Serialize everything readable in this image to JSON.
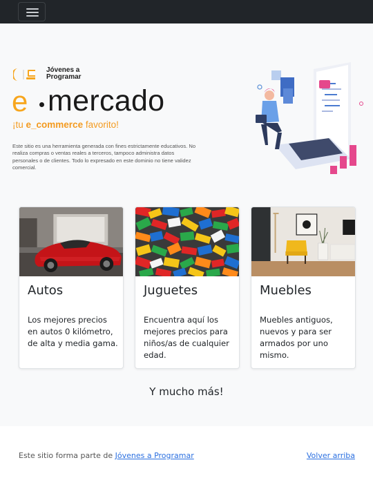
{
  "navbar": {
    "toggle_icon": "menu-icon"
  },
  "hero": {
    "logo_line1": "Jóvenes a",
    "logo_line2": "Programar",
    "brand_e": "e",
    "brand_word": "mercado",
    "tagline_pre": "¡tu ",
    "tagline_bold": "e_commerce",
    "tagline_post": " favorito!",
    "disclaimer": "Este sitio es una herramienta generada con fines estrictamente educativos. No realiza compras o ventas reales a terceros, tampoco administra datos personales o de clientes. Todo lo expresado en este dominio no tiene validez comercial.",
    "illustration": "person-with-laptop-coding-illustration"
  },
  "cards": [
    {
      "title": "Autos",
      "text": "Los mejores precios en autos 0 kilómetro, de alta y media gama.",
      "image": "red-sports-car"
    },
    {
      "title": "Juguetes",
      "text": "Encuentra aquí los mejores precios para niños/as de cualquier edad.",
      "image": "colorful-building-bricks"
    },
    {
      "title": "Muebles",
      "text": "Muebles antiguos, nuevos y para ser armados por uno mismo.",
      "image": "living-room-yellow-armchair"
    }
  ],
  "more_text": "Y mucho más!",
  "footer": {
    "text_prefix": "Este sitio forma parte de ",
    "link_label": "Jóvenes a Programar",
    "back_to_top": "Volver arriba"
  },
  "colors": {
    "navbar_bg": "#212529",
    "accent_orange": "#f7a61e",
    "link_blue": "#2a6fe0",
    "page_bg": "#f8f9fa"
  }
}
